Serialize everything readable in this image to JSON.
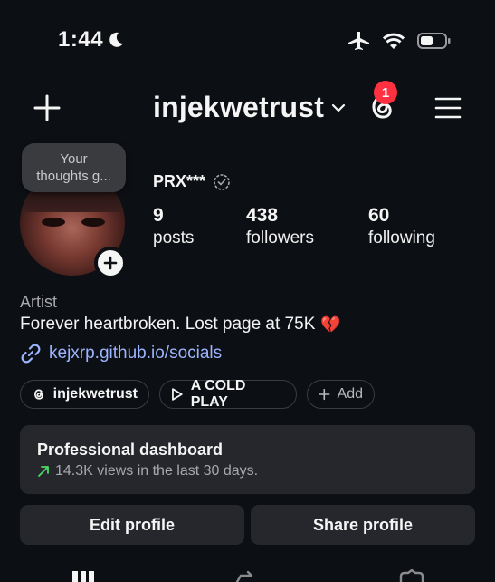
{
  "status_bar": {
    "time": "1:44",
    "icons": [
      "moon-icon",
      "airplane-icon",
      "wifi-icon",
      "battery-icon"
    ]
  },
  "header": {
    "username": "injekwetrust",
    "notification_count": "1",
    "icons": [
      "plus-icon",
      "chevron-down-icon",
      "threads-icon",
      "menu-icon"
    ]
  },
  "profile": {
    "thought_bubble": [
      "Your",
      "thoughts g..."
    ],
    "display_name": "PRX***",
    "stats": [
      {
        "value": "9",
        "label": "posts"
      },
      {
        "value": "438",
        "label": "followers"
      },
      {
        "value": "60",
        "label": "following"
      }
    ],
    "category": "Artist",
    "bio": "Forever heartbroken. Lost page at 75K",
    "bio_emoji": "💔",
    "link": "kejxrp.github.io/socials"
  },
  "chips": [
    {
      "label": "injekwetrust",
      "icon": "threads-icon"
    },
    {
      "label": "A COLD PLAY",
      "icon": "play-icon"
    },
    {
      "label": "Add",
      "icon": "plus-icon"
    }
  ],
  "dashboard": {
    "title": "Professional dashboard",
    "subtitle": "14.3K views in the last 30 days."
  },
  "actions": {
    "edit": "Edit profile",
    "share": "Share profile"
  },
  "colors": {
    "background": "#0c0f14",
    "surface": "#25272d",
    "link": "#9db4ff",
    "badge": "#ff3040",
    "trend": "#4cd964"
  }
}
